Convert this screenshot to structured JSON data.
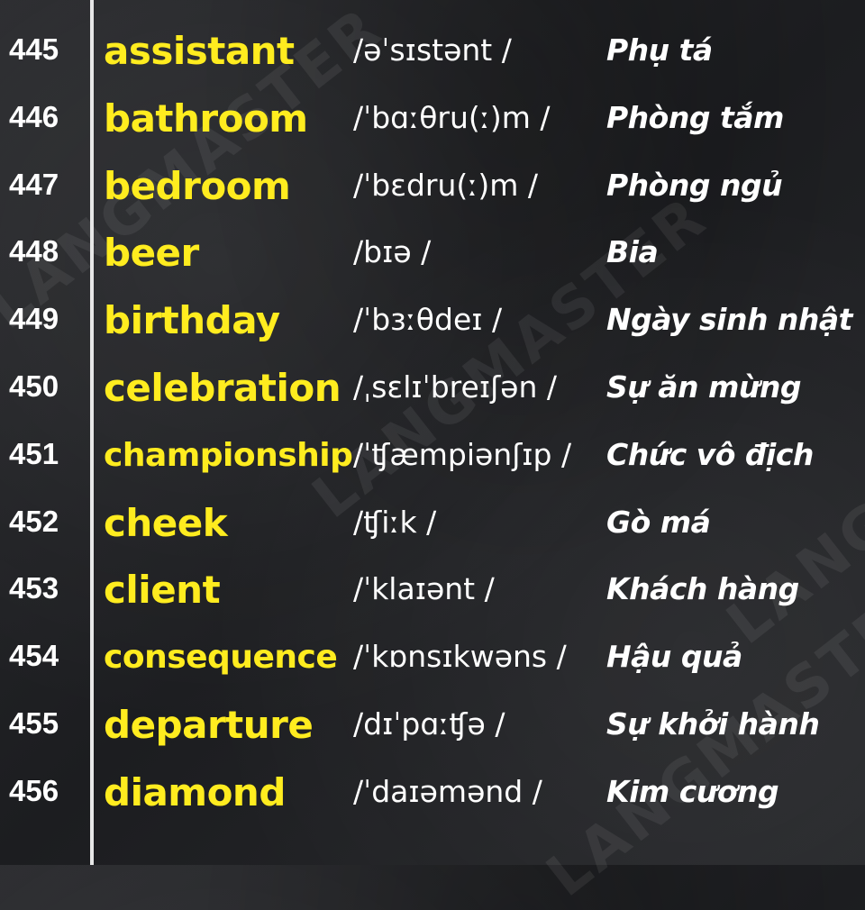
{
  "watermark_text": "LANGMASTER",
  "colors": {
    "word": "#ffec1f",
    "text": "#ffffff",
    "background": "#222326",
    "divider": "#e6e6e6"
  },
  "entries": [
    {
      "num": "445",
      "word": "assistant",
      "ipa": "/əˈsɪstənt /",
      "meaning": "Phụ tá"
    },
    {
      "num": "446",
      "word": "bathroom",
      "ipa": "/ˈbɑːθru(ː)m /",
      "meaning": "Phòng tắm"
    },
    {
      "num": "447",
      "word": "bedroom",
      "ipa": "/ˈbɛdru(ː)m /",
      "meaning": "Phòng ngủ"
    },
    {
      "num": "448",
      "word": "beer",
      "ipa": "/bɪə /",
      "meaning": "Bia"
    },
    {
      "num": "449",
      "word": "birthday",
      "ipa": "/ˈbɜːθdeɪ /",
      "meaning": "Ngày sinh nhật"
    },
    {
      "num": "450",
      "word": "celebration",
      "ipa": "/ˌsɛlɪˈbreɪʃən /",
      "meaning": "Sự ăn mừng"
    },
    {
      "num": "451",
      "word": "championship",
      "ipa": "/ˈʧæmpiənʃɪp /",
      "meaning": "Chức vô địch"
    },
    {
      "num": "452",
      "word": "cheek",
      "ipa": "/ʧiːk /",
      "meaning": "Gò má"
    },
    {
      "num": "453",
      "word": "client",
      "ipa": "/ˈklaɪənt /",
      "meaning": "Khách hàng"
    },
    {
      "num": "454",
      "word": "consequence",
      "ipa": "/ˈkɒnsɪkwəns /",
      "meaning": "Hậu quả"
    },
    {
      "num": "455",
      "word": "departure",
      "ipa": "/dɪˈpɑːʧə /",
      "meaning": "Sự khởi hành"
    },
    {
      "num": "456",
      "word": "diamond",
      "ipa": "/ˈdaɪəmənd /",
      "meaning": "Kim cương"
    }
  ]
}
